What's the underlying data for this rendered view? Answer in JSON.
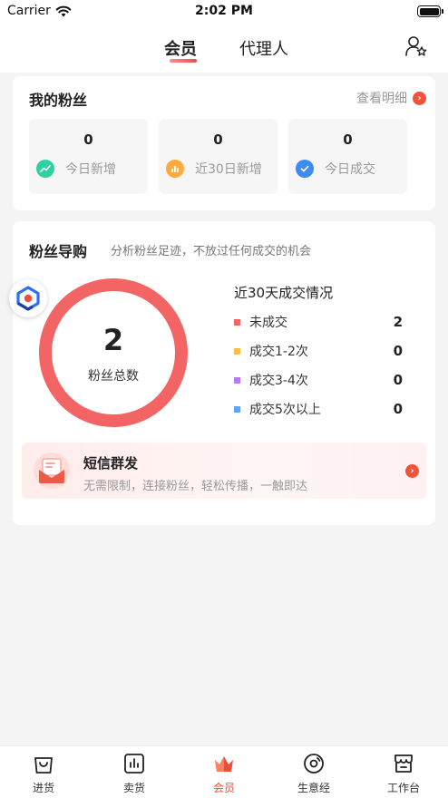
{
  "status": {
    "carrier": "Carrier",
    "time": "2:02 PM"
  },
  "header": {
    "tabs": [
      {
        "label": "会员",
        "active": true
      },
      {
        "label": "代理人",
        "active": false
      }
    ]
  },
  "fans": {
    "title": "我的粉丝",
    "detail_link": "查看明细",
    "stats": [
      {
        "value": "0",
        "label": "今日新增",
        "icon": "trend-icon",
        "color": "#2fd1a3"
      },
      {
        "value": "0",
        "label": "近30日新增",
        "icon": "bar-chart-icon",
        "color": "#ffaa3a"
      },
      {
        "value": "0",
        "label": "今日成交",
        "icon": "check-icon",
        "color": "#3c8cf2"
      }
    ]
  },
  "guide": {
    "title": "粉丝导购",
    "subtitle": "分析粉丝足迹，不放过任何成交的机会",
    "total_value": "2",
    "total_label": "粉丝总数",
    "legend_title": "近30天成交情况",
    "legend": [
      {
        "label": "未成交",
        "value": "2",
        "color": "#f36464"
      },
      {
        "label": "成交1-2次",
        "value": "0",
        "color": "#f5c04a"
      },
      {
        "label": "成交3-4次",
        "value": "0",
        "color": "#b47cf0"
      },
      {
        "label": "成交5次以上",
        "value": "0",
        "color": "#5aa6f5"
      }
    ],
    "ring_color": "#f36464"
  },
  "sms": {
    "title": "短信群发",
    "desc": "无需限制，连接粉丝，轻松传播，一触即达"
  },
  "nav": {
    "items": [
      {
        "label": "进货",
        "icon": "bag-icon"
      },
      {
        "label": "卖货",
        "icon": "chart-icon"
      },
      {
        "label": "会员",
        "icon": "crown-icon",
        "active": true
      },
      {
        "label": "生意经",
        "icon": "disc-icon"
      },
      {
        "label": "工作台",
        "icon": "store-icon"
      }
    ]
  },
  "colors": {
    "accent": "#e8503d",
    "arrow": "#f0533a"
  }
}
